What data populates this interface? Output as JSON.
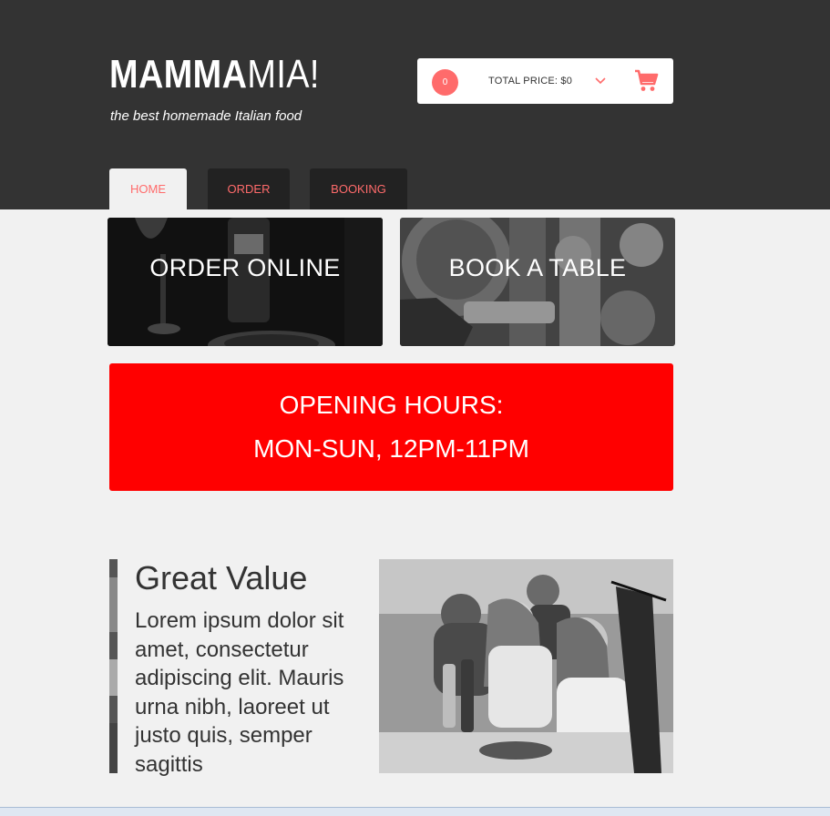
{
  "brand": {
    "name_bold": "MAMMA",
    "name_light": "MIA!",
    "tagline": "the best homemade Italian food"
  },
  "cart": {
    "count": "0",
    "total_label": "TOTAL PRICE: $0",
    "chevron_icon": "chevron-down-icon",
    "cart_icon": "shopping-cart-icon"
  },
  "nav": {
    "tabs": [
      {
        "label": "HOME",
        "active": true
      },
      {
        "label": "ORDER",
        "active": false
      },
      {
        "label": "BOOKING",
        "active": false
      }
    ]
  },
  "tiles": {
    "order_label": "ORDER ONLINE",
    "book_label": "BOOK A TABLE"
  },
  "hours": {
    "line1": "OPENING HOURS:",
    "line2": "MON-SUN, 12PM-11PM"
  },
  "feature": {
    "title": "Great Value",
    "text": "Lorem ipsum dolor sit amet, consectetur adipiscing elit. Mauris urna nibh, laoreet ut justo quis, semper sagittis"
  },
  "colors": {
    "header_bg": "#333333",
    "accent": "#ff6b6b",
    "hours_bg": "#ff0000",
    "page_bg": "#f1f1f1"
  }
}
